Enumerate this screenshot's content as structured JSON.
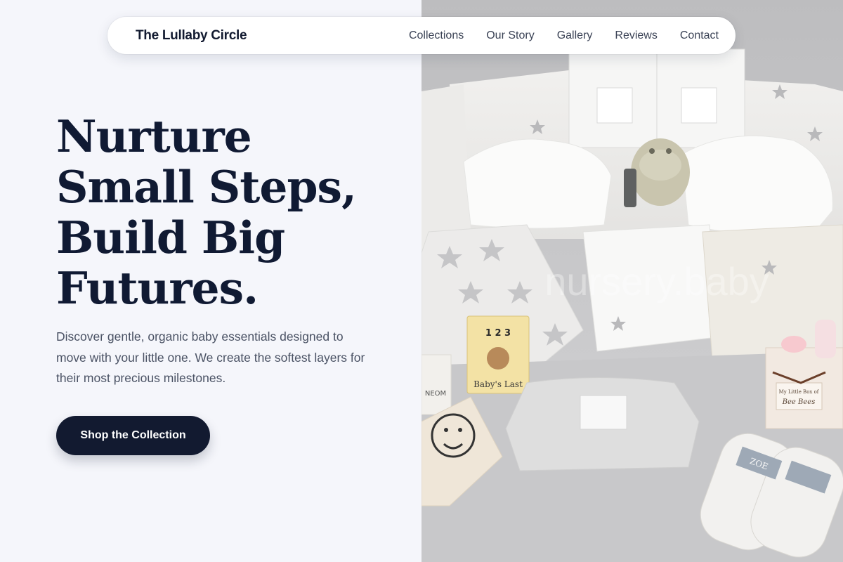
{
  "nav": {
    "brand": "The Lullaby Circle",
    "links": [
      "Collections",
      "Our Story",
      "Gallery",
      "Reviews",
      "Contact"
    ]
  },
  "hero": {
    "title_lines": [
      "Nurture",
      "Small Steps,",
      "Build Big",
      "Futures."
    ],
    "description": "Discover gentle, organic baby essentials designed to move with your little one. We create the softest layers for their most precious milestones.",
    "cta_label": "Shop the Collection"
  },
  "photo": {
    "watermark": "nursery.baby",
    "book_numbers": "1 2 3",
    "book_title": "Baby's Last",
    "tin_label": "Bee Bees",
    "tin_subtitle": "My Little Box of",
    "jar_label": "NEOM",
    "muslin_label": "ZOE"
  },
  "colors": {
    "primary": "#121a30",
    "page_bg": "#f5f6fb",
    "text_muted": "#4a5264"
  }
}
